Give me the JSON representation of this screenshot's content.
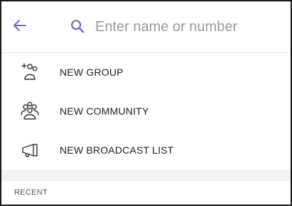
{
  "search": {
    "placeholder": "Enter name or number",
    "accent_color": "#7B61D4"
  },
  "menu": {
    "items": [
      {
        "label": "NEW GROUP",
        "icon": "add-group-icon"
      },
      {
        "label": "NEW COMMUNITY",
        "icon": "community-icon"
      },
      {
        "label": "NEW BROADCAST LIST",
        "icon": "megaphone-icon"
      }
    ]
  },
  "recent": {
    "header": "RECENT"
  }
}
